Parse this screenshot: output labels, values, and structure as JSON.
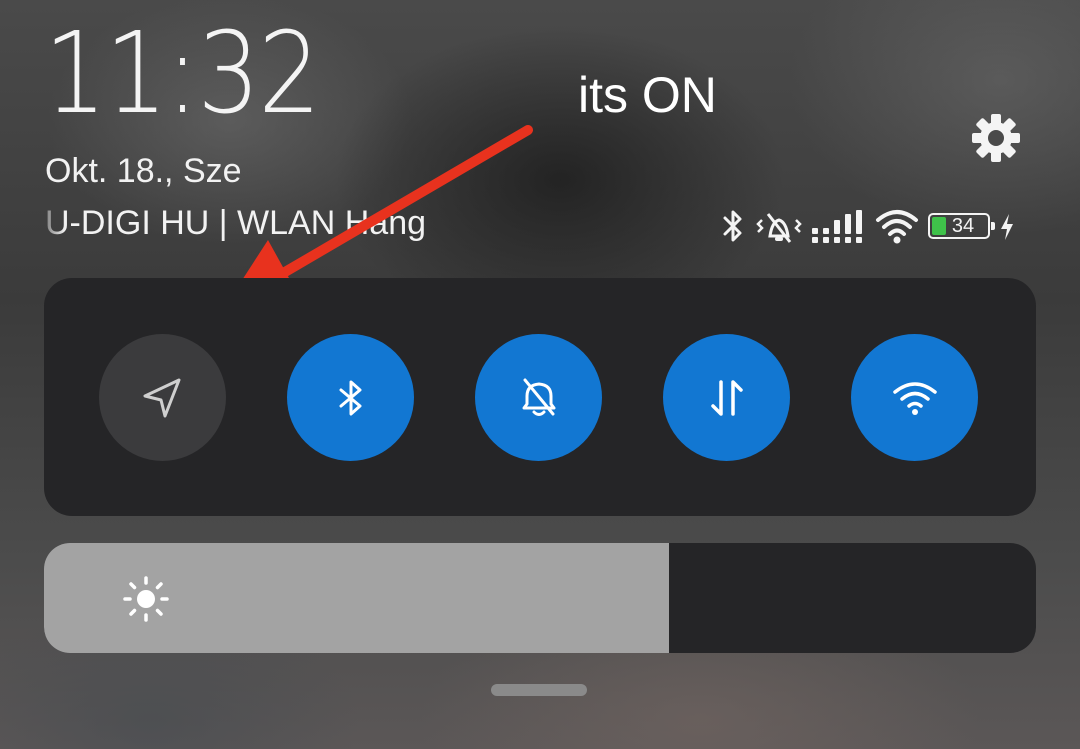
{
  "header": {
    "time": "11:32",
    "date": "Okt. 18., Sze",
    "carrier": "U-DIGI HU | WLAN Hang"
  },
  "status_bar": {
    "icons": [
      "bluetooth-icon",
      "vibrate-silent-icon",
      "signal-icon",
      "wifi-icon",
      "battery-icon",
      "charging-icon"
    ],
    "battery_level": "34"
  },
  "annotation": {
    "text": "its ON",
    "color": "#e8321e"
  },
  "quick_toggles": [
    {
      "name": "location",
      "icon": "location-arrow-icon",
      "state": "off"
    },
    {
      "name": "bluetooth",
      "icon": "bluetooth-icon",
      "state": "on"
    },
    {
      "name": "silent",
      "icon": "bell-off-icon",
      "state": "on"
    },
    {
      "name": "mobile-data",
      "icon": "data-arrows-icon",
      "state": "on"
    },
    {
      "name": "wifi",
      "icon": "wifi-icon",
      "state": "on"
    }
  ],
  "brightness": {
    "level": 0.63,
    "icon": "sun-icon"
  },
  "colors": {
    "accent": "#1277d2",
    "tile_off": "#3b3b3d",
    "panel": "#252527",
    "brightness_fill": "#a3a3a3",
    "battery": "#3fc24a"
  }
}
